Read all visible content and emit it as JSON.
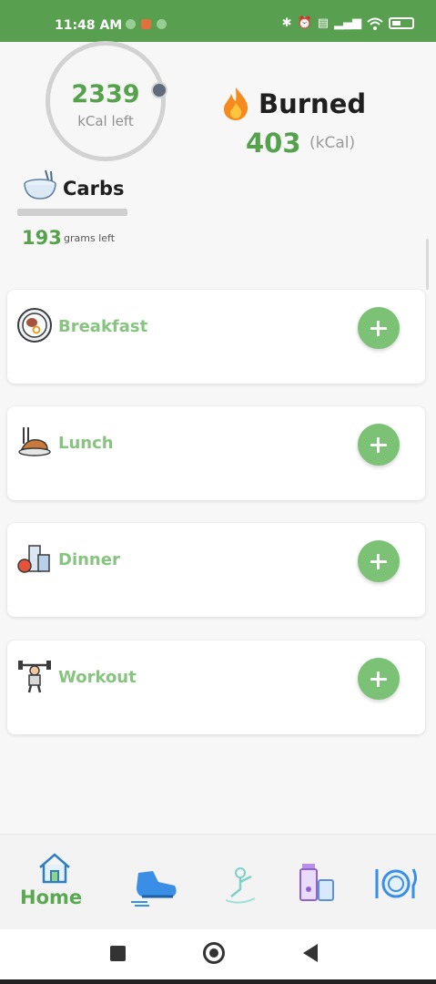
{
  "status_bar": {
    "time": "11:48 AM",
    "icons": [
      "whatsapp-icon",
      "recording-icon",
      "notification-dot-icon",
      "bluetooth-icon",
      "alarm-icon",
      "volte-icon",
      "signal-icon",
      "wifi-icon",
      "battery-icon"
    ]
  },
  "summary": {
    "kcal_left_value": "2339",
    "kcal_left_unit": "kCal left",
    "burned_title": "Burned",
    "burned_value": "403",
    "burned_unit": "(kCal)",
    "carbs_title": "Carbs",
    "carbs_value": "193",
    "carbs_unit": "grams left"
  },
  "meals": [
    {
      "label": "Breakfast",
      "icon": "breakfast-plate-icon"
    },
    {
      "label": "Lunch",
      "icon": "lunch-chicken-icon"
    },
    {
      "label": "Dinner",
      "icon": "dinner-groceries-icon"
    },
    {
      "label": "Workout",
      "icon": "weightlifter-icon"
    }
  ],
  "bottom_nav": {
    "home_label": "Home",
    "items": [
      "home-icon",
      "running-shoe-icon",
      "stretch-icon",
      "drinks-icon",
      "plate-cutlery-icon"
    ]
  },
  "colors": {
    "brand_green": "#58a04f",
    "accent_green": "#56a14c",
    "light_green": "#86c47f"
  }
}
